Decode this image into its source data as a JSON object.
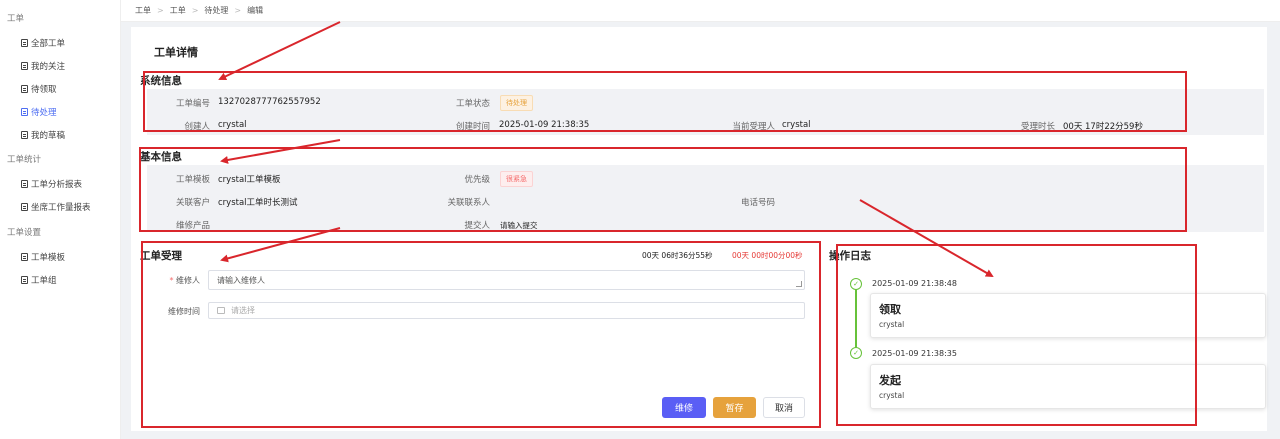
{
  "sidebar": {
    "group1": "工单",
    "items1": [
      "全部工单",
      "我的关注",
      "待领取",
      "待处理",
      "我的草稿"
    ],
    "group2": "工单统计",
    "items2": [
      "工单分析报表",
      "坐席工作量报表"
    ],
    "group3": "工单设置",
    "items3": [
      "工单模板",
      "工单组"
    ]
  },
  "breadcrumb": [
    "工单",
    "工单",
    "待处理",
    "编辑"
  ],
  "page_title": "工单详情",
  "system_info": {
    "title": "系统信息",
    "ticket_no_label": "工单编号",
    "ticket_no": "1327028777762557952",
    "status_label": "工单状态",
    "status": "待处理",
    "creator_label": "创建人",
    "creator": "crystal",
    "created_time_label": "创建时间",
    "created_time": "2025-01-09 21:38:35",
    "handler_label": "当前受理人",
    "handler": "crystal",
    "duration_label": "受理时长",
    "duration": "00天 17时22分59秒"
  },
  "basic_info": {
    "title": "基本信息",
    "template_label": "工单模板",
    "template": "crystal工单模板",
    "priority_label": "优先级",
    "priority": "很紧急",
    "customer_label": "关联客户",
    "customer": "crystal工单时长测试",
    "contact_label": "关联联系人",
    "phone_label": "电话号码",
    "product_label": "维修产品",
    "submitter_label": "提交人",
    "submitter": "请输入提交"
  },
  "handling": {
    "title": "工单受理",
    "timer1": "00天 06时36分55秒",
    "timer2": "00天 00时00分00秒",
    "repairer_label": "维修人",
    "repairer_required": "*",
    "repairer_placeholder": "请输入维修人",
    "time_label": "维修时间",
    "time_placeholder": "请选择",
    "btn_repair": "维修",
    "btn_save": "暂存",
    "btn_cancel": "取消"
  },
  "log": {
    "title": "操作日志",
    "entries": [
      {
        "time": "2025-01-09 21:38:48",
        "action": "领取",
        "user": "crystal"
      },
      {
        "time": "2025-01-09 21:38:35",
        "action": "发起",
        "user": "crystal"
      }
    ]
  },
  "colors": {
    "accent": "#4e6ef2",
    "primary_button": "#5a5ef5",
    "warning": "#e6a23c",
    "danger": "#f56c6c",
    "success": "#67c23a",
    "annotation": "#d9262c"
  }
}
